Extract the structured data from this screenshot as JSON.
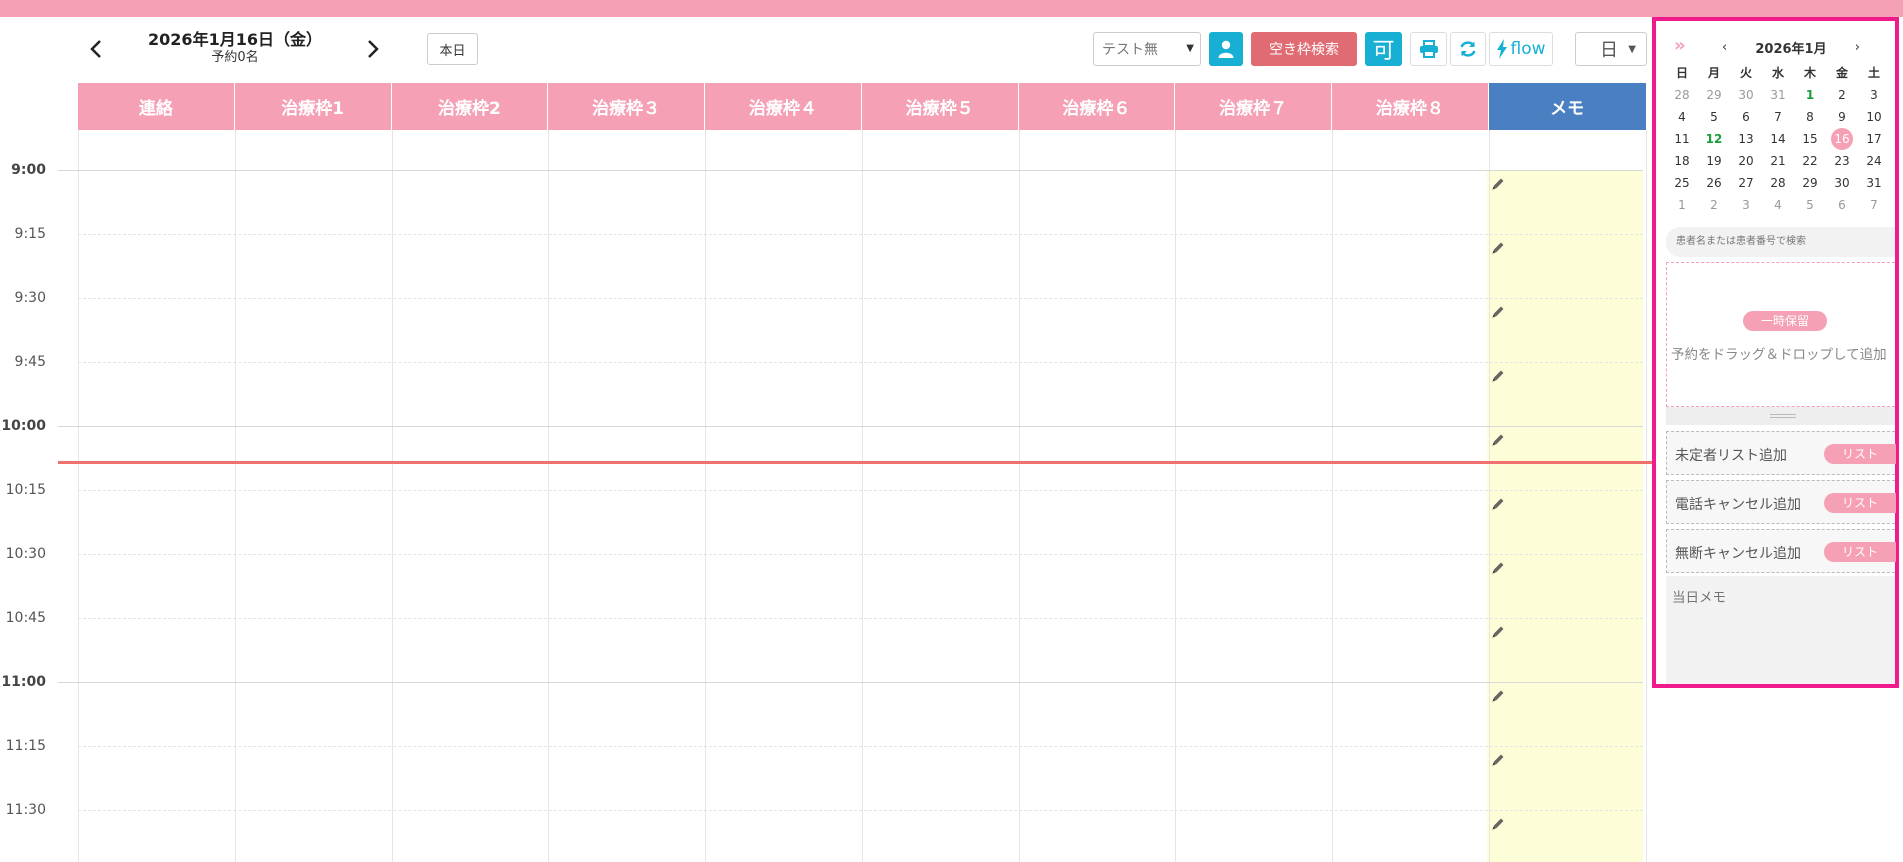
{
  "header": {
    "date_title": "2026年1月16日（金）",
    "reservation_count": "予約0名",
    "today_label": "本日",
    "prev_icon": "chevron-left-icon",
    "next_icon": "chevron-right-icon"
  },
  "toolbar": {
    "select_value": "テスト無",
    "vacancy_search_label": "空き枠検索",
    "ka_label": "可",
    "flow_label": "flow",
    "view_value": "日",
    "accent_color": "#17b0d4",
    "vacancy_color": "#e06b73"
  },
  "columns": [
    "連絡",
    "治療枠1",
    "治療枠2",
    "治療枠３",
    "治療枠４",
    "治療枠５",
    "治療枠６",
    "治療枠７",
    "治療枠８",
    "メモ"
  ],
  "times": [
    {
      "label": "9:00",
      "hour": true
    },
    {
      "label": "9:15",
      "hour": false
    },
    {
      "label": "9:30",
      "hour": false
    },
    {
      "label": "9:45",
      "hour": false
    },
    {
      "label": "10:00",
      "hour": true
    },
    {
      "label": "10:15",
      "hour": false
    },
    {
      "label": "10:30",
      "hour": false
    },
    {
      "label": "10:45",
      "hour": false
    },
    {
      "label": "11:00",
      "hour": true
    },
    {
      "label": "11:15",
      "hour": false
    },
    {
      "label": "11:30",
      "hour": false
    }
  ],
  "mini_calendar": {
    "title": "2026年1月",
    "prev": "‹",
    "next": "›",
    "collapse": "»",
    "dow": [
      "日",
      "月",
      "火",
      "水",
      "木",
      "金",
      "土"
    ],
    "weeks": [
      [
        "28",
        "29",
        "30",
        "31",
        "1",
        "2",
        "3"
      ],
      [
        "4",
        "5",
        "6",
        "7",
        "8",
        "9",
        "10"
      ],
      [
        "11",
        "12",
        "13",
        "14",
        "15",
        "16",
        "17"
      ],
      [
        "18",
        "19",
        "20",
        "21",
        "22",
        "23",
        "24"
      ],
      [
        "25",
        "26",
        "27",
        "28",
        "29",
        "30",
        "31"
      ],
      [
        "1",
        "2",
        "3",
        "4",
        "5",
        "6",
        "7"
      ]
    ],
    "selected": "16",
    "holidays": [
      "1",
      "12"
    ]
  },
  "side": {
    "search_placeholder": "患者名または患者番号で検索",
    "hold_badge": "一時保留",
    "hold_text": "予約をドラッグ＆ドロップして追加",
    "lists": [
      {
        "label": "未定者リスト追加",
        "button": "リスト"
      },
      {
        "label": "電話キャンセル追加",
        "button": "リスト"
      },
      {
        "label": "無断キャンセル追加",
        "button": "リスト"
      }
    ],
    "day_memo_placeholder": "当日メモ"
  }
}
